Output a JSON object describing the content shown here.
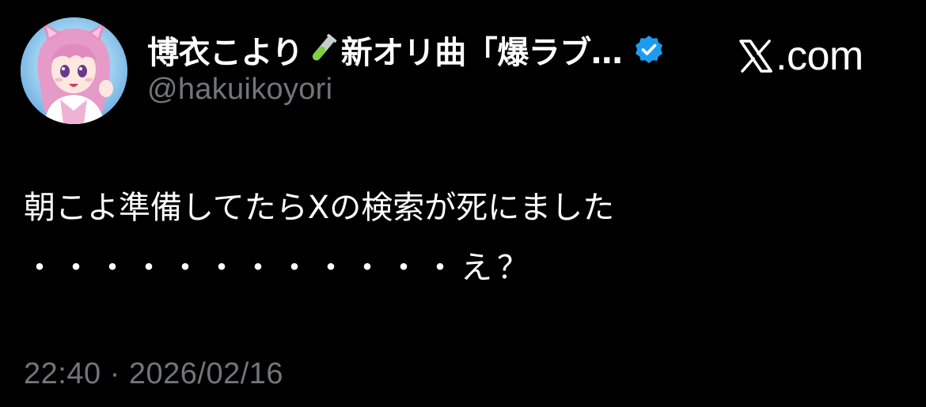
{
  "author": {
    "name_prefix": "博衣こより",
    "name_suffix": "新オリ曲「爆ラブ…",
    "name_icon": "test-tube-icon",
    "verified_icon": "verified-badge-icon",
    "handle": "@hakuikoyori",
    "avatar": "profile-avatar"
  },
  "brand": {
    "logo_icon": "x-logo-icon",
    "text": ".com"
  },
  "post": {
    "line1": "朝こよ準備してたらXの検索が死にました",
    "line2": "・・・・・・・・・・・・え？"
  },
  "meta": {
    "timestamp": "22:40 · 2026/02/16"
  },
  "colors": {
    "background": "#000000",
    "text_primary": "#ffffff",
    "text_secondary": "#71767b",
    "verified_blue": "#1d9bf0",
    "test_tube_green": "#7fd13b"
  }
}
